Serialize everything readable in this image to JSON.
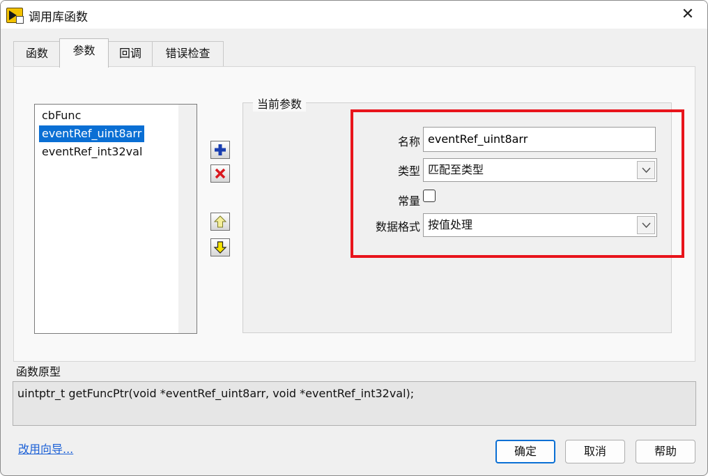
{
  "window": {
    "title": "调用库函数",
    "close_glyph": "✕"
  },
  "tabs": [
    {
      "label": "函数",
      "active": false
    },
    {
      "label": "参数",
      "active": true
    },
    {
      "label": "回调",
      "active": false
    },
    {
      "label": "错误检查",
      "active": false
    }
  ],
  "param_list": {
    "items": [
      "cbFunc",
      "eventRef_uint8arr",
      "eventRef_int32val"
    ],
    "selected_index": 1
  },
  "side_buttons": {
    "icons": [
      "add-icon",
      "delete-icon",
      "move-up-icon",
      "move-down-icon"
    ]
  },
  "current_param": {
    "group_title": "当前参数",
    "name_label": "名称",
    "name_value": "eventRef_uint8arr",
    "type_label": "类型",
    "type_value": "匹配至类型",
    "constant_label": "常量",
    "constant_checked": false,
    "data_format_label": "数据格式",
    "data_format_value": "按值处理"
  },
  "prototype": {
    "label": "函数原型",
    "text": "uintptr_t getFuncPtr(void *eventRef_uint8arr, void *eventRef_int32val);"
  },
  "footer": {
    "wizard_link": "改用向导...",
    "ok_label": "确定",
    "cancel_label": "取消",
    "help_label": "帮助"
  },
  "colors": {
    "accent": "#0a6fd4",
    "highlight": "#e8141b",
    "selection": "#0a6fd4",
    "link": "#1a5fd6"
  }
}
